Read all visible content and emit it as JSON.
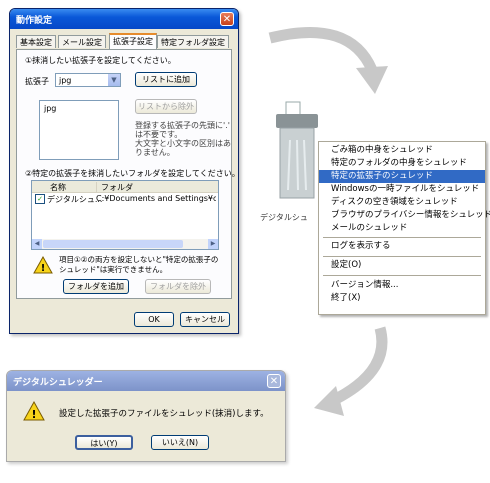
{
  "settings_dialog": {
    "title": "動作設定",
    "close_glyph": "✕",
    "tabs": [
      "基本設定",
      "メール設定",
      "拡張子設定",
      "特定フォルダ設定"
    ],
    "section1_heading": "①抹消したい拡張子を設定してください。",
    "ext_label": "拡張子",
    "ext_value": "jpg",
    "add_button": "リストに追加",
    "remove_button": "リストから除外",
    "ext_list": [
      "jpg"
    ],
    "hint_lines": [
      "登録する拡張子の先頭に'.'",
      "は不要です。",
      "大文字と小文字の区別はあ",
      "りません。"
    ],
    "section2_heading": "②特定の拡張子を抹消したいフォルダを設定してください。",
    "table_headers": [
      "名称",
      "フォルダ"
    ],
    "table_rows": [
      {
        "name": "デジタルシュ...",
        "folder": "C:¥Documents and Settings¥chieko_r"
      }
    ],
    "warning_text": "項目①②の両方を設定しないと\"特定の拡張子の\nシュレッド\"は実行できません。",
    "add_folder_button": "フォルダを追加",
    "remove_folder_button": "フォルダを除外",
    "ok_button": "OK",
    "cancel_button": "キャンセル"
  },
  "desktop_icon_label": "デジタルシュ",
  "context_menu": {
    "items": [
      {
        "label": "ごみ箱の中身をシュレッド",
        "highlighted": false
      },
      {
        "label": "特定のフォルダの中身をシュレッド",
        "highlighted": false
      },
      {
        "label": "特定の拡張子のシュレッド",
        "highlighted": true
      },
      {
        "label": "Windowsの一時ファイルをシュレッド",
        "highlighted": false
      },
      {
        "label": "ディスクの空き領域をシュレッド",
        "highlighted": false
      },
      {
        "label": "ブラウザのプライバシー情報をシュレッド",
        "highlighted": false
      },
      {
        "label": "メールのシュレッド",
        "highlighted": false
      },
      {
        "separator": true
      },
      {
        "label": "ログを表示する",
        "highlighted": false
      },
      {
        "separator": true
      },
      {
        "label": "設定(O)",
        "highlighted": false
      },
      {
        "separator": true
      },
      {
        "label": "バージョン情報...",
        "highlighted": false
      },
      {
        "label": "終了(X)",
        "highlighted": false
      }
    ]
  },
  "confirm_dialog": {
    "title": "デジタルシュレッダー",
    "message": "設定した拡張子のファイルをシュレッド(抹消)します。",
    "yes_button": "はい(Y)",
    "no_button": "いいえ(N)",
    "close_glyph": "✕"
  },
  "colors": {
    "xp_title_blue": "#0a58d8",
    "menu_highlight": "#316ac5",
    "dialog_bg": "#ece9d8",
    "arrow_gray": "#c8c8c8"
  }
}
